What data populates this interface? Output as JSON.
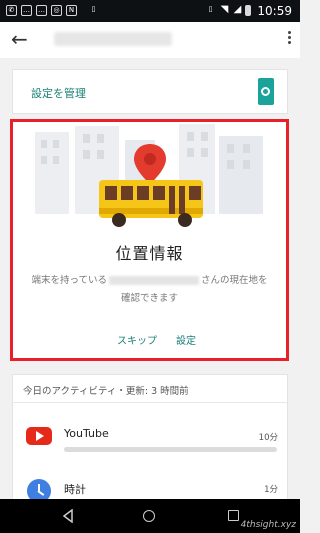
{
  "status_bar": {
    "time": "10:59",
    "icons": [
      "whatsapp-icon",
      "chat-icon",
      "chat-icon",
      "instagram-icon",
      "nfc-icon",
      "mobile-data-icon",
      "vibrate-icon",
      "wifi-icon",
      "signal-icon",
      "battery-icon"
    ]
  },
  "app_bar": {
    "back_icon": "arrow-left-icon",
    "more_icon": "more-vert-icon"
  },
  "manage_card": {
    "label": "設定を管理",
    "icon": "phone-settings-icon"
  },
  "location_card": {
    "title": "位置情報",
    "desc_before": "端末を持っている",
    "desc_after": "さんの現在地を",
    "desc_line2": "確認できます",
    "skip_label": "スキップ",
    "settings_label": "設定",
    "illustration": "bus-with-location-pin",
    "highlight_color": "#e8202a"
  },
  "activity_card": {
    "header": "今日のアクティビティ・更新: 3 時間前",
    "apps": [
      {
        "name": "YouTube",
        "time": "10分",
        "icon": "youtube-icon"
      },
      {
        "name": "時計",
        "time": "1分",
        "icon": "clock-icon"
      }
    ]
  },
  "nav_bar": {
    "icons": [
      "nav-back-icon",
      "nav-home-icon",
      "nav-recents-icon"
    ]
  },
  "watermark": "4thsight.xyz",
  "colors": {
    "accent": "#1a7f77",
    "youtube": "#e52a1b",
    "clock": "#3f7fe1"
  }
}
